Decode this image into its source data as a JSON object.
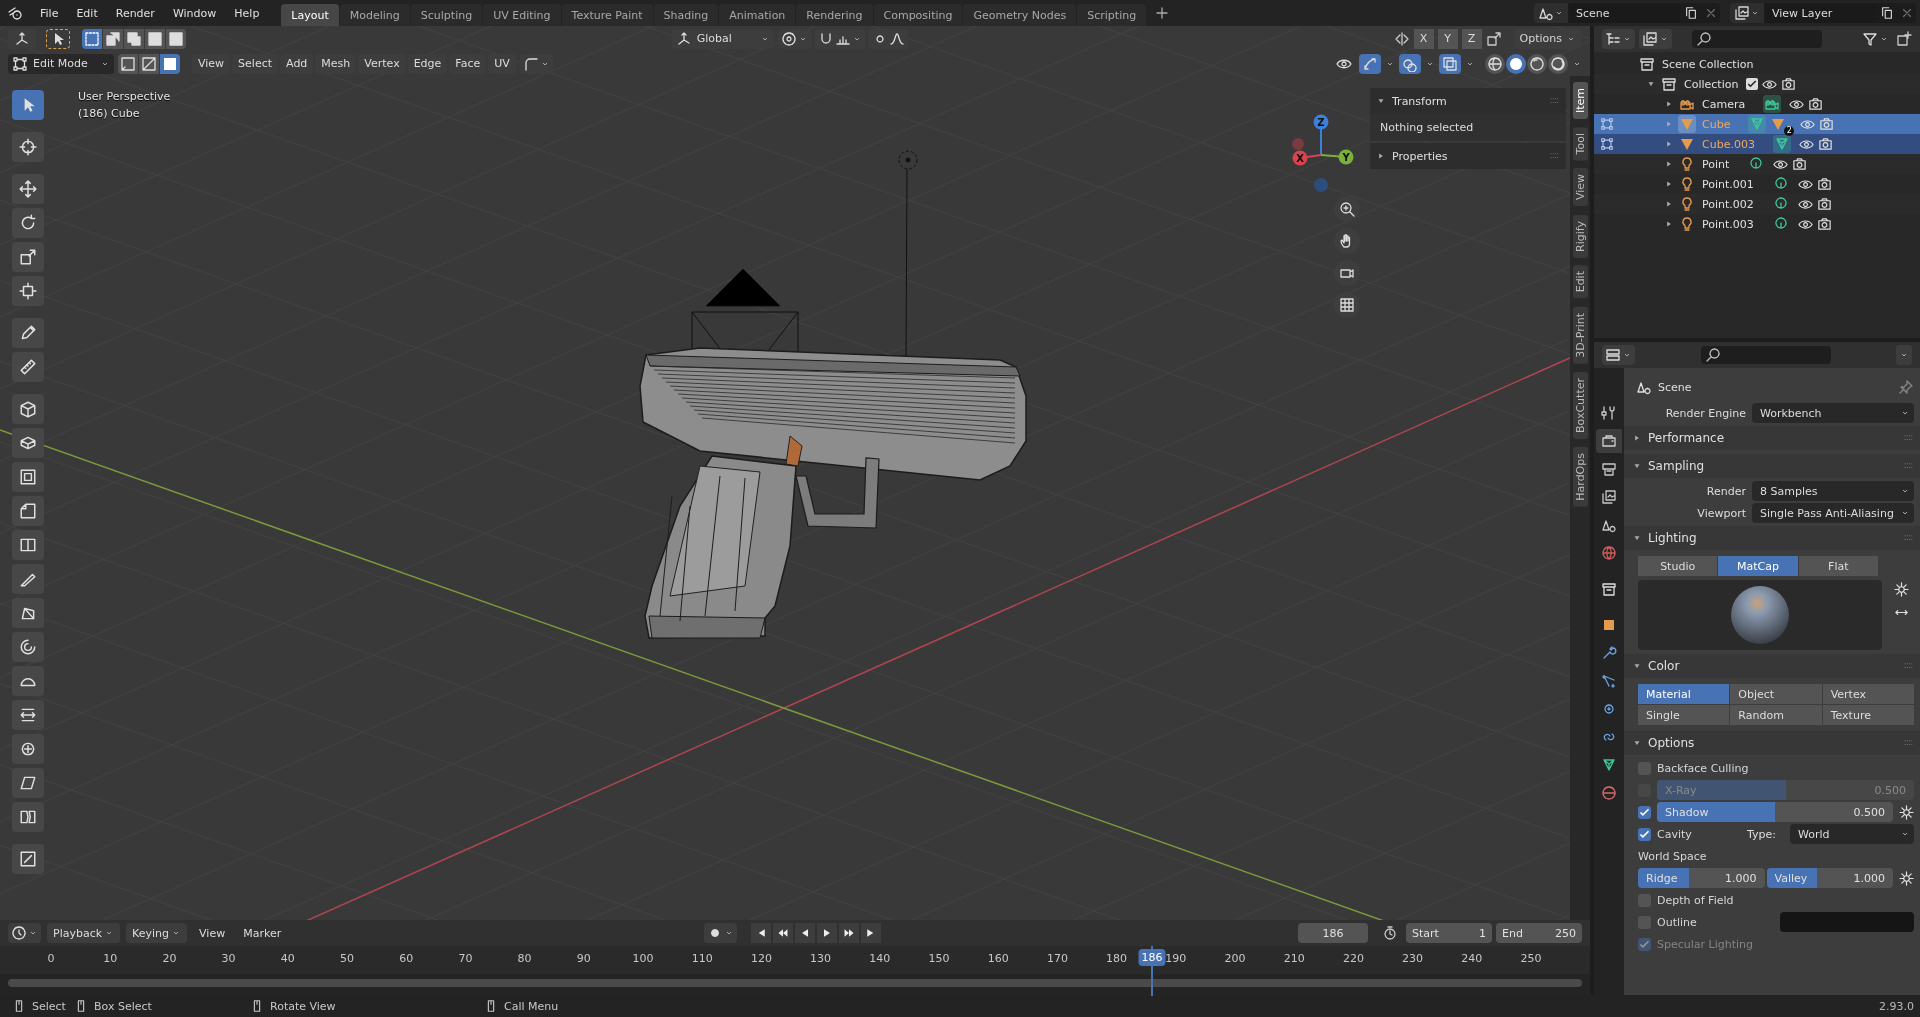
{
  "top_bar": {
    "menus": [
      "File",
      "Edit",
      "Render",
      "Window",
      "Help"
    ],
    "workspaces": [
      {
        "label": "Layout",
        "selected": true
      },
      {
        "label": "Modeling",
        "selected": false
      },
      {
        "label": "Sculpting",
        "selected": false
      },
      {
        "label": "UV Editing",
        "selected": false
      },
      {
        "label": "Texture Paint",
        "selected": false
      },
      {
        "label": "Shading",
        "selected": false
      },
      {
        "label": "Animation",
        "selected": false
      },
      {
        "label": "Rendering",
        "selected": false
      },
      {
        "label": "Compositing",
        "selected": false
      },
      {
        "label": "Geometry Nodes",
        "selected": false
      },
      {
        "label": "Scripting",
        "selected": false
      }
    ],
    "scene": "Scene",
    "view_layer": "View Layer"
  },
  "viewport": {
    "tool_header": {
      "select_box_modes": [
        {
          "selected": true
        },
        {
          "selected": false
        },
        {
          "selected": false
        },
        {
          "selected": false
        },
        {
          "selected": false
        }
      ],
      "orientation": "Global",
      "axes": [
        "X",
        "Y",
        "Z"
      ],
      "options": "Options"
    },
    "mode": "Edit Mode",
    "select_modes": [
      {
        "kind": "vertex",
        "selected": false
      },
      {
        "kind": "edge",
        "selected": false
      },
      {
        "kind": "face",
        "selected": true
      }
    ],
    "menus": [
      "View",
      "Select",
      "Add",
      "Mesh",
      "Vertex",
      "Edge",
      "Face",
      "UV"
    ],
    "toggles": [
      {
        "kind": "visibility",
        "on": false
      },
      {
        "kind": "gizmo",
        "on": true
      },
      {
        "kind": "overlay",
        "on": true
      },
      {
        "kind": "xray",
        "on": true
      }
    ],
    "shading_modes": [
      {
        "kind": "wireframe",
        "selected": false
      },
      {
        "kind": "solid",
        "selected": true
      },
      {
        "kind": "material",
        "selected": false
      },
      {
        "kind": "rendered",
        "selected": false
      }
    ],
    "info": [
      "User Perspective",
      "(186) Cube"
    ],
    "gizmo": {
      "x": "X",
      "y": "Y",
      "z": "Z"
    },
    "tools": [
      {
        "kind": "select",
        "selected": true
      },
      {
        "kind": "cursor",
        "selected": false
      },
      {
        "kind": "move",
        "selected": false
      },
      {
        "kind": "rotate",
        "selected": false
      },
      {
        "kind": "scale",
        "selected": false
      },
      {
        "kind": "transform",
        "selected": false
      },
      {
        "kind": "annotate",
        "selected": false
      },
      {
        "kind": "measure",
        "selected": false
      },
      {
        "kind": "addcube",
        "selected": false
      },
      {
        "kind": "extrude",
        "selected": false
      },
      {
        "kind": "inset",
        "selected": false
      },
      {
        "kind": "bevel",
        "selected": false
      },
      {
        "kind": "loopcut",
        "selected": false
      },
      {
        "kind": "knife",
        "selected": false
      },
      {
        "kind": "polybuild",
        "selected": false
      },
      {
        "kind": "spin",
        "selected": false
      },
      {
        "kind": "smooth",
        "selected": false
      },
      {
        "kind": "edgeslide",
        "selected": false
      },
      {
        "kind": "shrink",
        "selected": false
      },
      {
        "kind": "shear",
        "selected": false
      },
      {
        "kind": "rip",
        "selected": false
      },
      {
        "kind": "square",
        "selected": false
      }
    ],
    "sidebar": {
      "tabs": [
        {
          "label": "Item",
          "selected": true
        },
        {
          "label": "Tool",
          "selected": false
        },
        {
          "label": "View",
          "selected": false
        },
        {
          "label": "Rigify",
          "selected": false
        },
        {
          "label": "Edit",
          "selected": false
        },
        {
          "label": "3D-Print",
          "selected": false
        },
        {
          "label": "BoxCutter",
          "selected": false
        },
        {
          "label": "HardOps",
          "selected": false
        }
      ],
      "panels": [
        {
          "title": "Transform",
          "expanded": true,
          "text": "Nothing selected"
        },
        {
          "title": "Properties",
          "expanded": false
        }
      ]
    }
  },
  "timeline": {
    "menus": [
      "Playback",
      "Keying",
      "View",
      "Marker"
    ],
    "current_frame": "186",
    "start_label": "Start",
    "start": "1",
    "end_label": "End",
    "end": "250",
    "ruler": [
      "0",
      "10",
      "20",
      "30",
      "40",
      "50",
      "60",
      "70",
      "80",
      "90",
      "100",
      "110",
      "120",
      "130",
      "140",
      "150",
      "160",
      "170",
      "180",
      "190",
      "200",
      "210",
      "220",
      "230",
      "240",
      "250"
    ],
    "playhead": {
      "label": "186",
      "level": 0.744
    }
  },
  "outliner": {
    "root": "Scene Collection",
    "items": [
      {
        "name": "Collection",
        "kind": "collection",
        "expanded": true,
        "checked": true,
        "selected": false,
        "active": false,
        "in_edit_mode": false,
        "children": [
          {
            "name": "Camera",
            "kind": "camera",
            "expanded": false,
            "selected": false,
            "active": false,
            "in_edit_mode": false
          },
          {
            "name": "Cube",
            "kind": "mesh",
            "expanded": false,
            "selected": true,
            "active": true,
            "in_edit_mode": true,
            "child_count": "2"
          },
          {
            "name": "Cube.003",
            "kind": "mesh",
            "expanded": false,
            "selected": true,
            "active": false,
            "in_edit_mode": true
          },
          {
            "name": "Point",
            "kind": "light",
            "expanded": false,
            "selected": false,
            "active": false,
            "in_edit_mode": false
          },
          {
            "name": "Point.001",
            "kind": "light",
            "expanded": false,
            "selected": false,
            "active": false,
            "in_edit_mode": false
          },
          {
            "name": "Point.002",
            "kind": "light",
            "expanded": false,
            "selected": false,
            "active": false,
            "in_edit_mode": false
          },
          {
            "name": "Point.003",
            "kind": "light",
            "expanded": false,
            "selected": false,
            "active": false,
            "in_edit_mode": false
          }
        ]
      }
    ]
  },
  "properties": {
    "tabs": [
      {
        "kind": "tool",
        "selected": false
      },
      {
        "kind": "render",
        "selected": true
      },
      {
        "kind": "output",
        "selected": false
      },
      {
        "kind": "viewlayer",
        "selected": false
      },
      {
        "kind": "scene",
        "selected": false
      },
      {
        "kind": "world",
        "selected": false
      },
      {
        "kind": "collection",
        "selected": false
      },
      {
        "kind": "object",
        "selected": false
      },
      {
        "kind": "modifier",
        "selected": false
      },
      {
        "kind": "particles",
        "selected": false
      },
      {
        "kind": "physics",
        "selected": false
      },
      {
        "kind": "constraints",
        "selected": false
      },
      {
        "kind": "data",
        "selected": false
      },
      {
        "kind": "material",
        "selected": false
      }
    ],
    "rows": [
      {
        "kind": "context",
        "text": "Scene"
      },
      {
        "kind": "dropdown",
        "label": "Render Engine",
        "value": "Workbench"
      },
      {
        "kind": "section",
        "title": "Performance",
        "expanded": false
      },
      {
        "kind": "section",
        "title": "Sampling",
        "expanded": true
      },
      {
        "kind": "dropdown",
        "label": "Render",
        "value": "8 Samples"
      },
      {
        "kind": "dropdown",
        "label": "Viewport",
        "value": "Single Pass Anti-Aliasing"
      },
      {
        "kind": "section",
        "title": "Lighting",
        "expanded": true
      },
      {
        "kind": "shading",
        "options": [
          {
            "label": "Studio",
            "selected": false
          },
          {
            "label": "MatCap",
            "selected": true
          },
          {
            "label": "Flat",
            "selected": false
          }
        ]
      },
      {
        "kind": "matcap"
      },
      {
        "kind": "section",
        "title": "Color",
        "expanded": true
      },
      {
        "kind": "grid",
        "options": [
          {
            "label": "Material",
            "selected": true
          },
          {
            "label": "Object",
            "selected": false
          },
          {
            "label": "Vertex",
            "selected": false
          },
          {
            "label": "Single",
            "selected": false
          },
          {
            "label": "Random",
            "selected": false
          },
          {
            "label": "Texture",
            "selected": false
          }
        ]
      },
      {
        "kind": "section",
        "title": "Options",
        "expanded": true
      },
      {
        "kind": "check",
        "label": "Backface Culling",
        "checked": false,
        "disabled": false
      },
      {
        "kind": "checkslider",
        "label": "X-Ray",
        "value": "0.500",
        "level": 0.5,
        "checked": false,
        "disabled": true,
        "gear": false
      },
      {
        "kind": "checkslider",
        "label": "Shadow",
        "value": "0.500",
        "level": 0.5,
        "checked": true,
        "disabled": false,
        "gear": true
      },
      {
        "kind": "cavity",
        "label": "Cavity",
        "checked": true,
        "type_label": "Type:",
        "value": "World"
      },
      {
        "kind": "label",
        "text": "World Space"
      },
      {
        "kind": "dualslider",
        "sliders": [
          {
            "label": "Ridge",
            "value": "1.000",
            "level": 0.4
          },
          {
            "label": "Valley",
            "value": "1.000",
            "level": 0.4
          }
        ]
      },
      {
        "kind": "check",
        "label": "Depth of Field",
        "checked": false,
        "disabled": false
      },
      {
        "kind": "swatch",
        "label": "Outline",
        "checked": false
      },
      {
        "kind": "check",
        "label": "Specular Lighting",
        "checked": true,
        "disabled": true
      }
    ]
  },
  "status_bar": {
    "hints": [
      "Select",
      "Box Select",
      "Rotate View",
      "Call Menu"
    ],
    "version": "2.93.0"
  }
}
